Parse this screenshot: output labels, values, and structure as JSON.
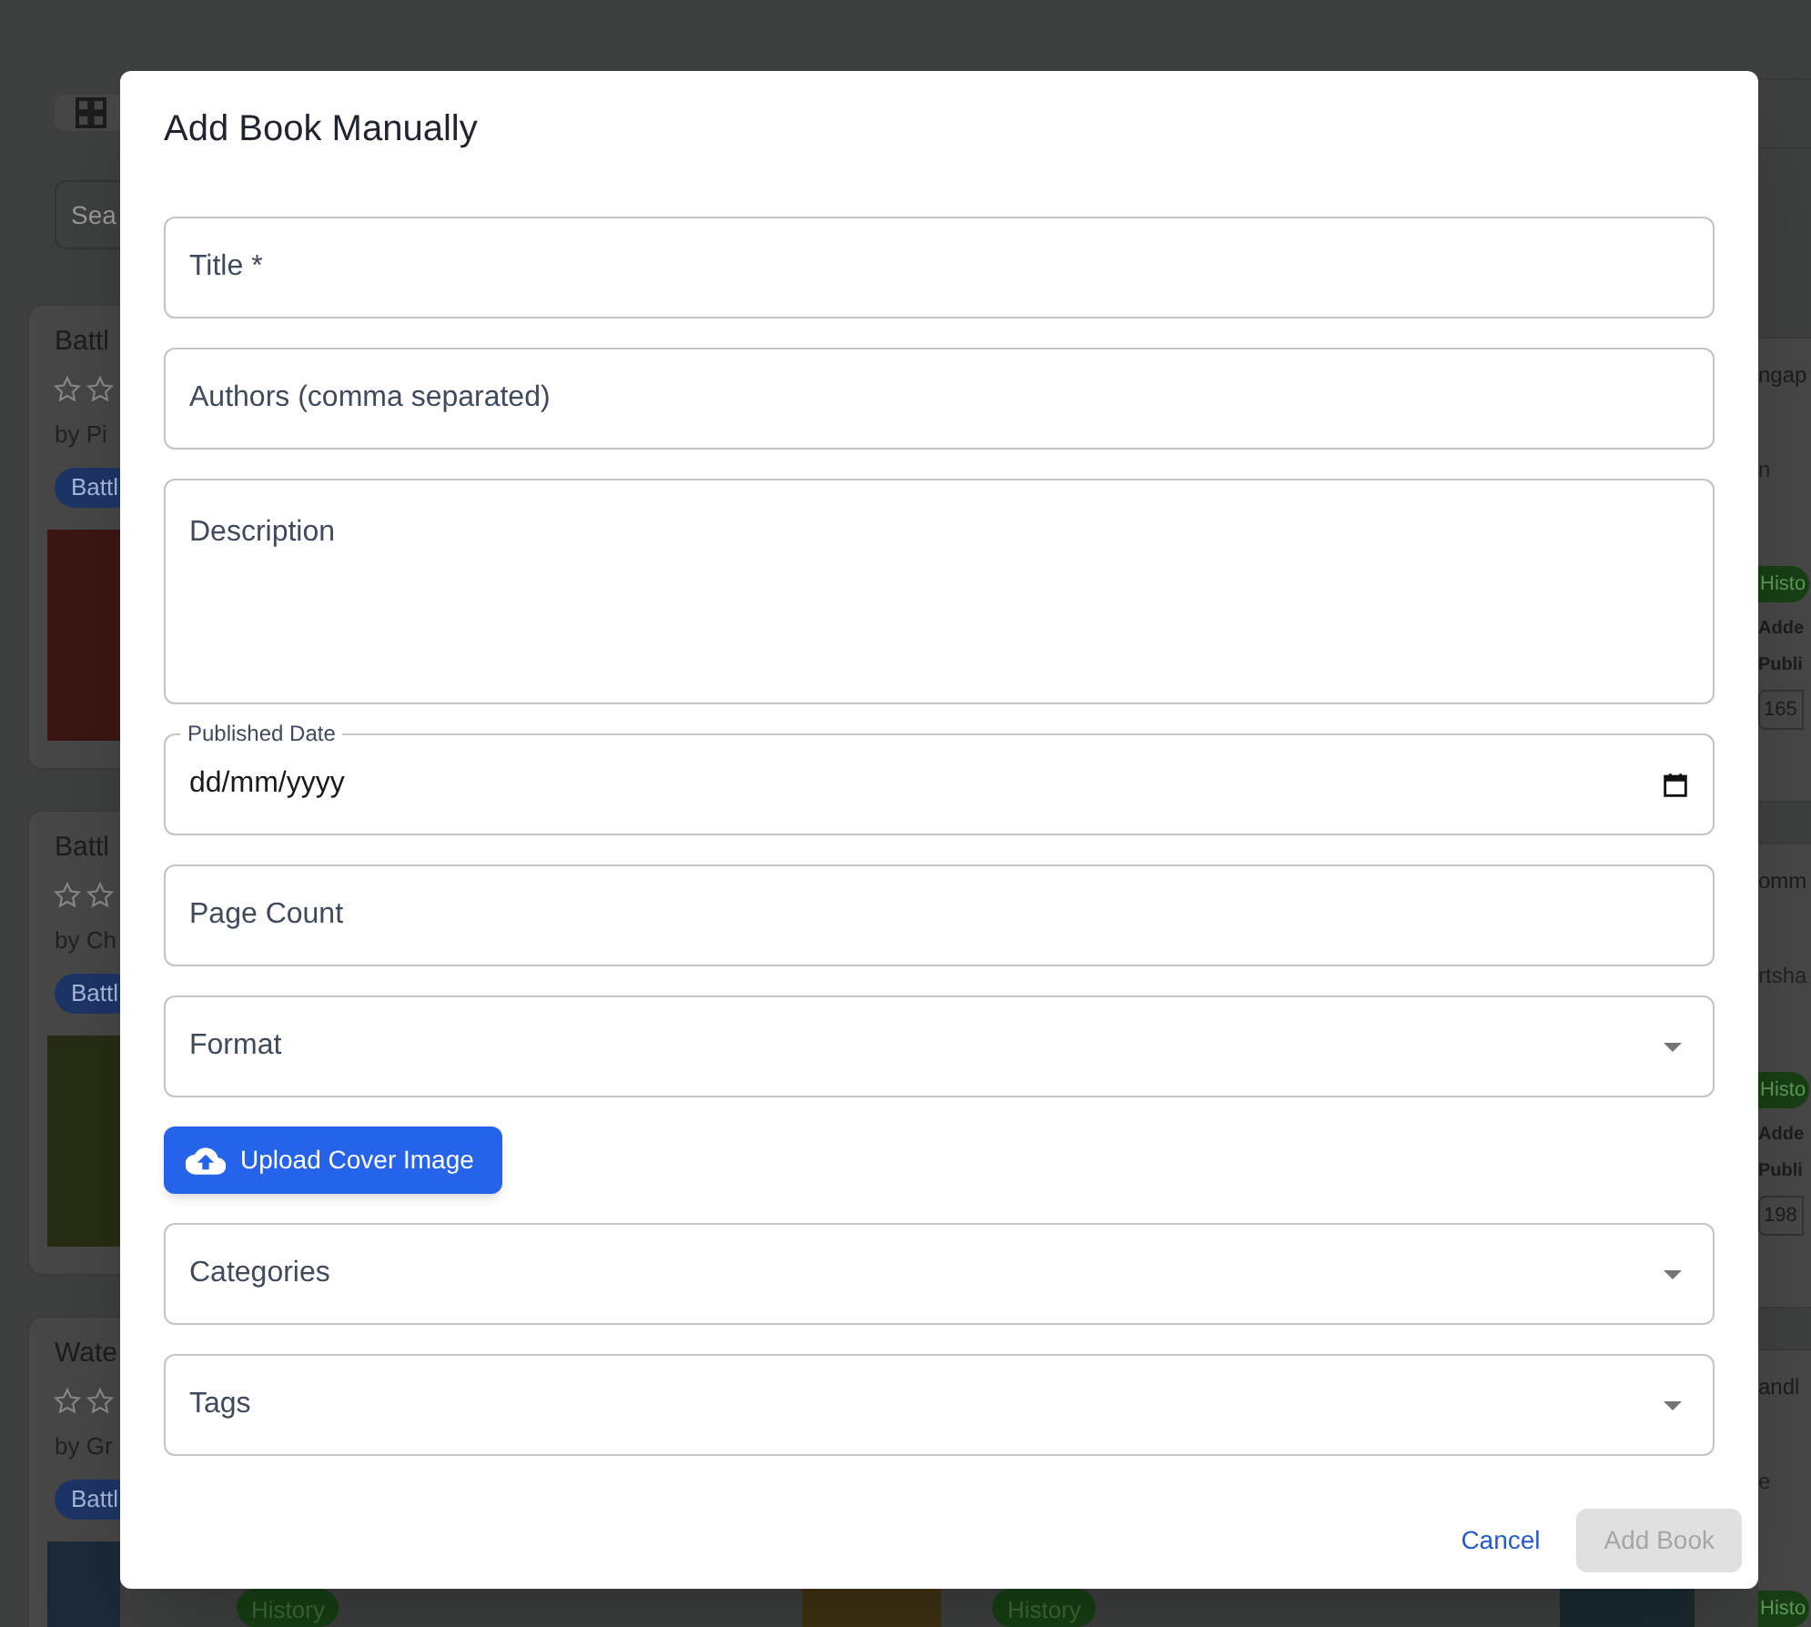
{
  "background": {
    "search": {
      "placeholder": "Sea"
    },
    "left_cards": [
      {
        "title": "Battl",
        "author": "by Pi",
        "category": "Battl"
      },
      {
        "title": "Battl",
        "author": "by Ch",
        "category": "Battl"
      },
      {
        "title": "Wate",
        "author": "by Gr",
        "category": "Battl"
      }
    ],
    "right_cards": [
      {
        "title": "ngap",
        "author": "n",
        "tag": "Histo",
        "added": "Adde",
        "published": "Publi",
        "pages": "165"
      },
      {
        "title": "omm",
        "author": "rtsha",
        "tag": "Histo",
        "added": "Adde",
        "published": "Publi",
        "pages": "198"
      },
      {
        "title": "andl",
        "author": "e",
        "tag": "Histo"
      }
    ],
    "bottom_tags": [
      "History",
      "History"
    ]
  },
  "dialog": {
    "title": "Add Book Manually",
    "fields": [
      {
        "kind": "text",
        "placeholder": "Title *"
      },
      {
        "kind": "text",
        "placeholder": "Authors (comma separated)"
      },
      {
        "kind": "textarea",
        "placeholder": "Description"
      },
      {
        "kind": "date",
        "label": "Published Date",
        "value": "dd/mm/yyyy"
      },
      {
        "kind": "text",
        "placeholder": "Page Count"
      },
      {
        "kind": "select",
        "label": "Format"
      },
      {
        "kind": "upload",
        "label": "Upload Cover Image"
      },
      {
        "kind": "select",
        "label": "Categories"
      },
      {
        "kind": "select",
        "label": "Tags"
      }
    ],
    "buttons": [
      {
        "label": "Cancel",
        "disabled": false,
        "kind": "text"
      },
      {
        "label": "Add Book",
        "disabled": true,
        "kind": "contained"
      }
    ]
  }
}
